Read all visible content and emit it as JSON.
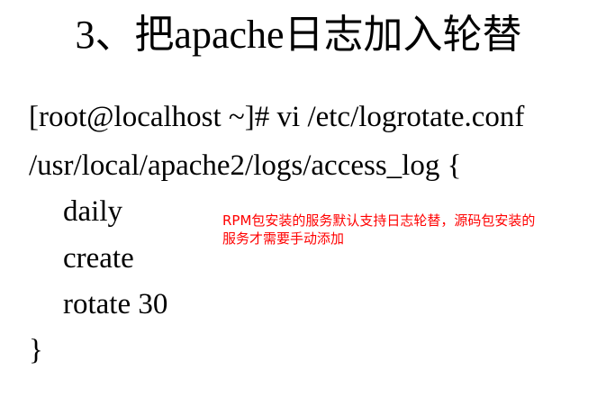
{
  "slide": {
    "title": "3、把apache日志加入轮替",
    "code_lines": [
      "[root@localhost ~]# vi /etc/logrotate.conf",
      "/usr/local/apache2/logs/access_log {",
      "daily",
      "create",
      "rotate 30",
      "}"
    ],
    "note_lines": [
      "RPM包安装的服务默认支持日志轮替，源码包安装的",
      "服务才需要手动添加"
    ],
    "note_color": "#ff0000"
  }
}
